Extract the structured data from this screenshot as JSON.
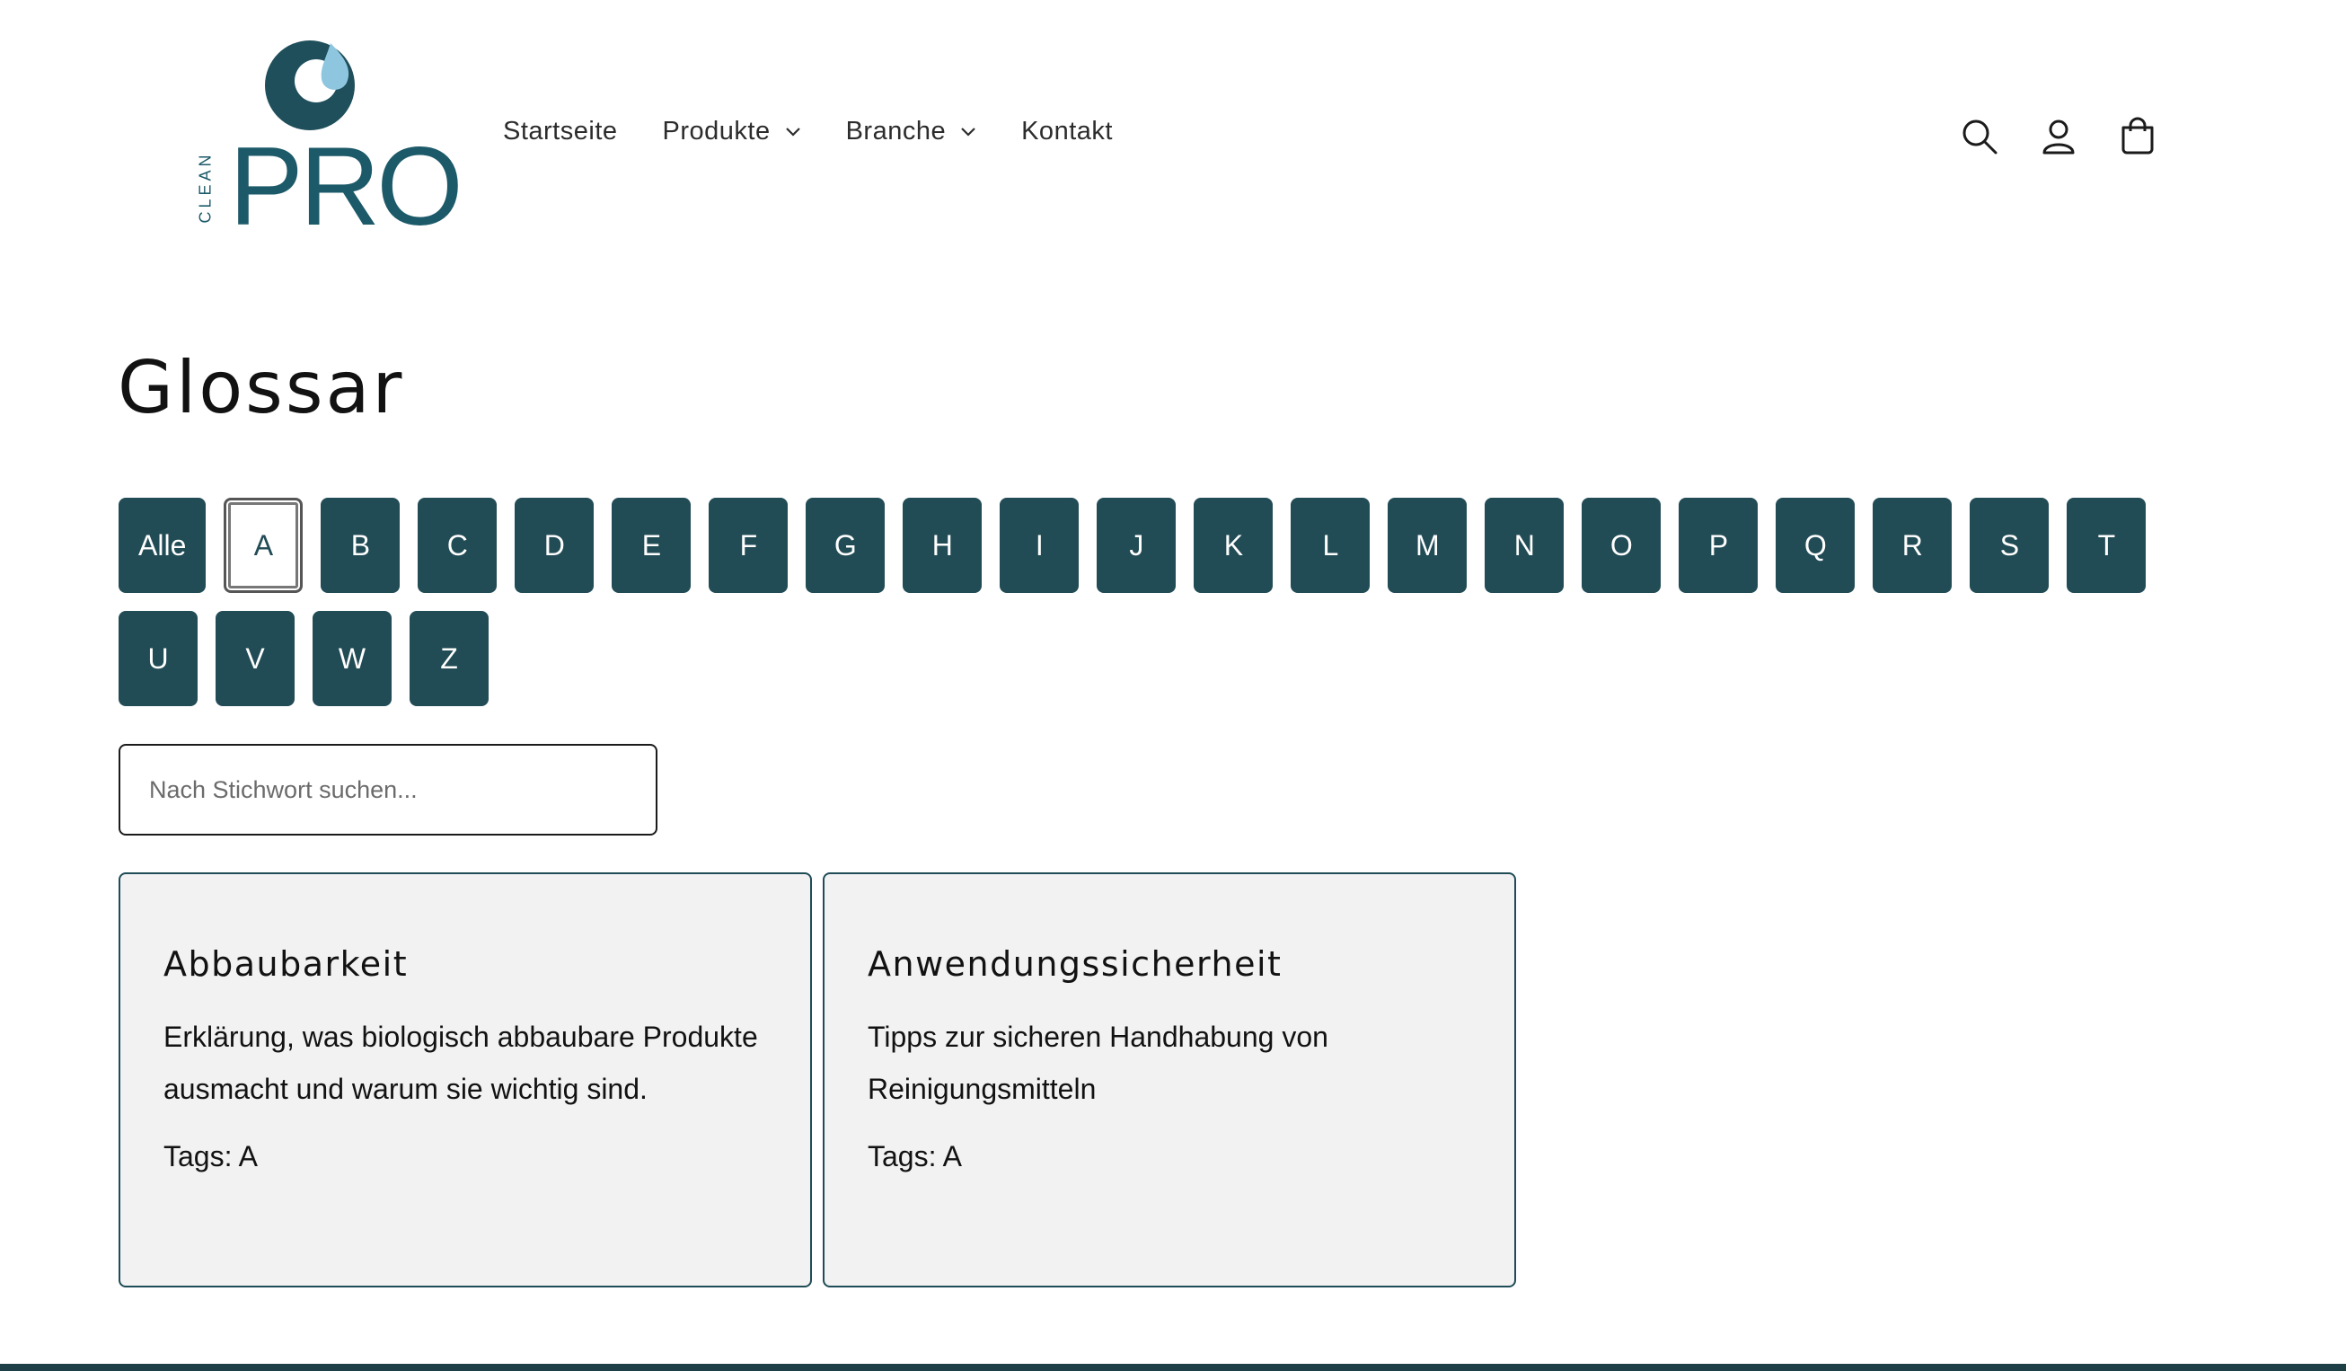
{
  "brand": {
    "name": "PRO",
    "tagline": "CLEAN",
    "color": "#1d5a69",
    "accent": "#8fc6df"
  },
  "nav": [
    {
      "label": "Startseite",
      "has_dropdown": false
    },
    {
      "label": "Produkte",
      "has_dropdown": true
    },
    {
      "label": "Branche",
      "has_dropdown": true
    },
    {
      "label": "Kontakt",
      "has_dropdown": false
    }
  ],
  "header_icons": [
    "search-icon",
    "account-icon",
    "cart-icon"
  ],
  "page_title": "Glossar",
  "filters": {
    "items": [
      "Alle",
      "A",
      "B",
      "C",
      "D",
      "E",
      "F",
      "G",
      "H",
      "I",
      "J",
      "K",
      "L",
      "M",
      "N",
      "O",
      "P",
      "Q",
      "R",
      "S",
      "T",
      "U",
      "V",
      "W",
      "Z"
    ],
    "active": "A",
    "button_color": "#214b55"
  },
  "search": {
    "placeholder": "Nach Stichwort suchen..."
  },
  "cards": [
    {
      "title": "Abbaubarkeit",
      "description": "Erklärung, was biologisch abbaubare Produkte ausmacht und warum sie wichtig sind.",
      "tags": "Tags: A"
    },
    {
      "title": "Anwendungssicherheit",
      "description": "Tipps zur sicheren Handhabung von Reinigungsmitteln",
      "tags": "Tags: A"
    }
  ]
}
